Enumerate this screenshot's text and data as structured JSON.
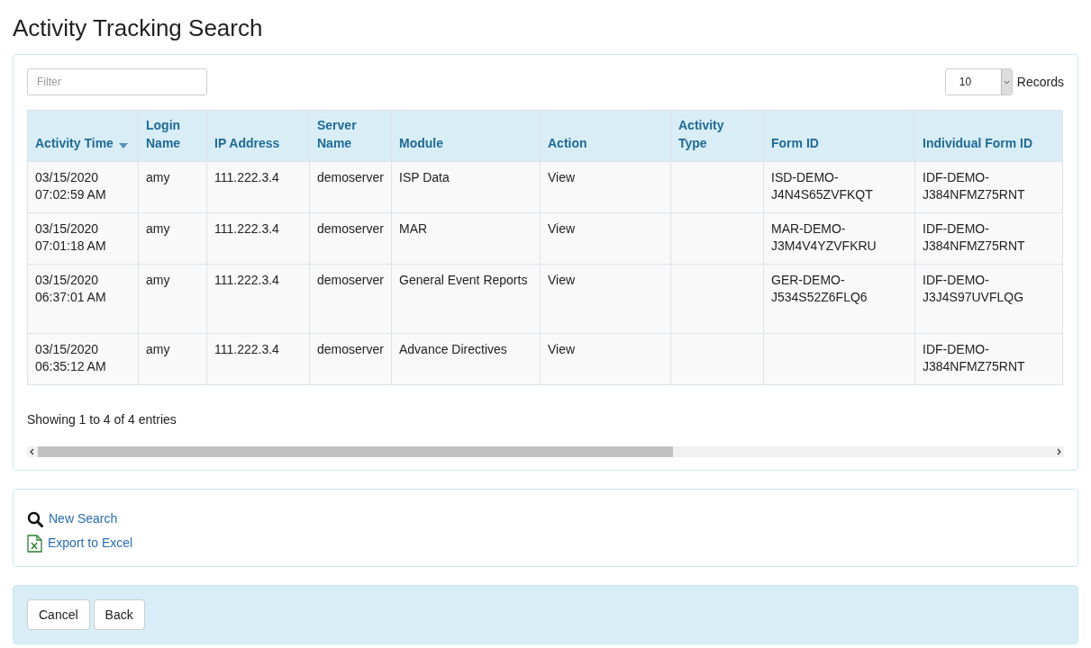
{
  "title": "Activity Tracking Search",
  "filter": {
    "placeholder": "Filter"
  },
  "page_size": {
    "value": "10",
    "label": "Records"
  },
  "table": {
    "columns": [
      {
        "label": "Activity Time",
        "sorted": true
      },
      {
        "label": "Login Name",
        "sorted": false
      },
      {
        "label": "IP Address",
        "sorted": false
      },
      {
        "label": "Server Name",
        "sorted": false
      },
      {
        "label": "Module",
        "sorted": false
      },
      {
        "label": "Action",
        "sorted": false
      },
      {
        "label": "Activity Type",
        "sorted": false
      },
      {
        "label": "Form ID",
        "sorted": false
      },
      {
        "label": "Individual Form ID",
        "sorted": false
      }
    ],
    "rows": [
      [
        "03/15/2020 07:02:59 AM",
        "amy",
        "111.222.3.4",
        "demoserver",
        "ISP Data",
        "View",
        "",
        "ISD-DEMO-J4N4S65ZVFKQT",
        "IDF-DEMO-J384NFMZ75RNT"
      ],
      [
        "03/15/2020 07:01:18 AM",
        "amy",
        "111.222.3.4",
        "demoserver",
        "MAR",
        "View",
        "",
        "MAR-DEMO-J3M4V4YZVFKRU",
        "IDF-DEMO-J384NFMZ75RNT"
      ],
      [
        "03/15/2020 06:37:01 AM",
        "amy",
        "111.222.3.4",
        "demoserver",
        "General Event Reports",
        "View",
        "",
        "GER-DEMO-J534S52Z6FLQ6",
        "IDF-DEMO-J3J4S97UVFLQG"
      ],
      [
        "03/15/2020 06:35:12 AM",
        "amy",
        "111.222.3.4",
        "demoserver",
        "Advance Directives",
        "View",
        "",
        "",
        "IDF-DEMO-J384NFMZ75RNT"
      ]
    ]
  },
  "info": "Showing 1 to 4 of 4 entries",
  "links": [
    {
      "kind": "search",
      "label": "New Search"
    },
    {
      "kind": "excel",
      "label": "Export to Excel"
    }
  ],
  "buttons": [
    "Cancel",
    "Back"
  ]
}
